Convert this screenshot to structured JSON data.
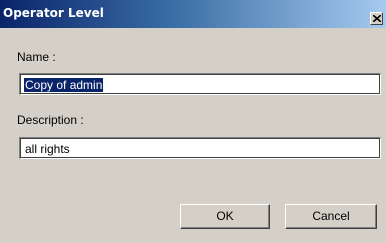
{
  "window": {
    "title": "Operator Level"
  },
  "form": {
    "name_label": "Name :",
    "name_value": "Copy of admin",
    "description_label": "Description :",
    "description_value": "all rights"
  },
  "buttons": {
    "ok_label": "OK",
    "cancel_label": "Cancel"
  },
  "colors": {
    "titlebar_start": "#0a246a",
    "titlebar_end": "#a6caf0",
    "selection": "#0a246a",
    "dialog_background": "#d4d0c8"
  },
  "icons": {
    "close": "close-icon"
  }
}
